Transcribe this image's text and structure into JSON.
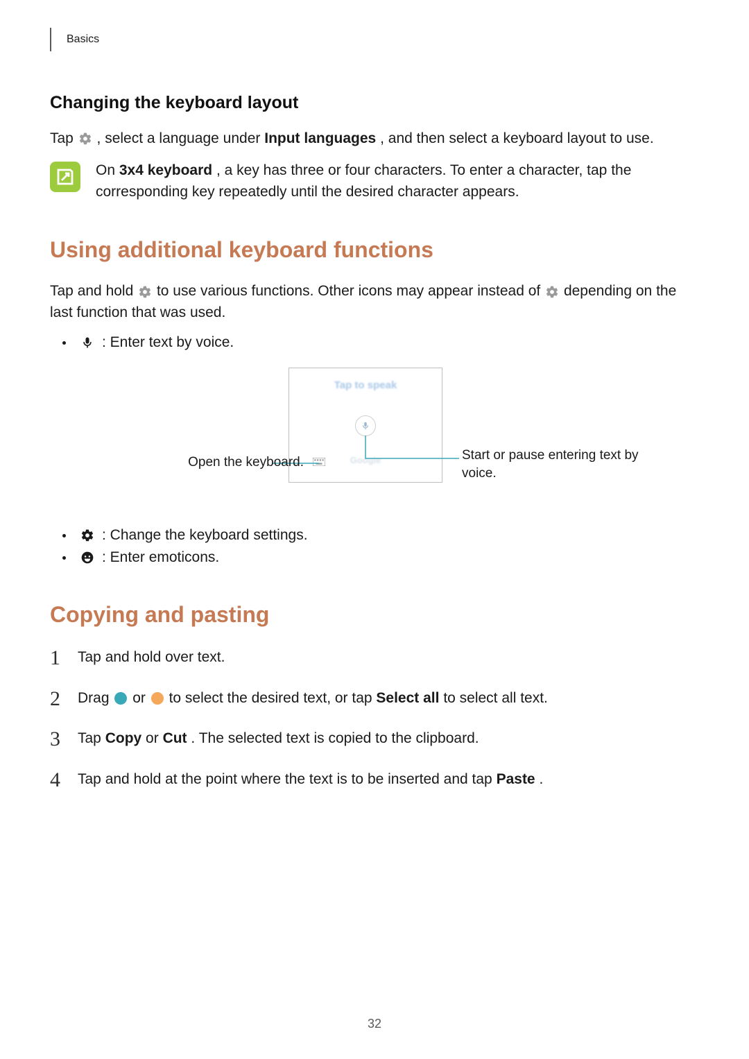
{
  "header": {
    "section_label": "Basics"
  },
  "sec1": {
    "heading": "Changing the keyboard layout",
    "para_pre": "Tap ",
    "para_mid": ", select a language under ",
    "para_bold": "Input languages",
    "para_post": ", and then select a keyboard layout to use.",
    "note_pre": "On ",
    "note_bold": "3x4 keyboard",
    "note_post": ", a key has three or four characters. To enter a character, tap the corresponding key repeatedly until the desired character appears."
  },
  "sec2": {
    "heading": "Using additional keyboard functions",
    "intro_pre": "Tap and hold ",
    "intro_mid": " to use various functions. Other icons may appear instead of ",
    "intro_post": " depending on the last function that was used.",
    "bullet_voice": " : Enter text by voice.",
    "bullet_settings": " : Change the keyboard settings.",
    "bullet_emoticons": " : Enter emoticons.",
    "diagram": {
      "tap_to_speak": "Tap to speak",
      "google": "Google",
      "callout_left": "Open the keyboard.",
      "callout_right": "Start or pause entering text by voice."
    }
  },
  "sec3": {
    "heading": "Copying and pasting",
    "steps": [
      {
        "text": "Tap and hold over text."
      },
      {
        "pre": "Drag ",
        "mid": " or ",
        "mid2": " to select the desired text, or tap ",
        "bold1": "Select all",
        "post": " to select all text."
      },
      {
        "pre": "Tap ",
        "bold1": "Copy",
        "mid": " or ",
        "bold2": "Cut",
        "post": ". The selected text is copied to the clipboard."
      },
      {
        "pre": "Tap and hold at the point where the text is to be inserted and tap ",
        "bold1": "Paste",
        "post": "."
      }
    ]
  },
  "page_number": "32"
}
